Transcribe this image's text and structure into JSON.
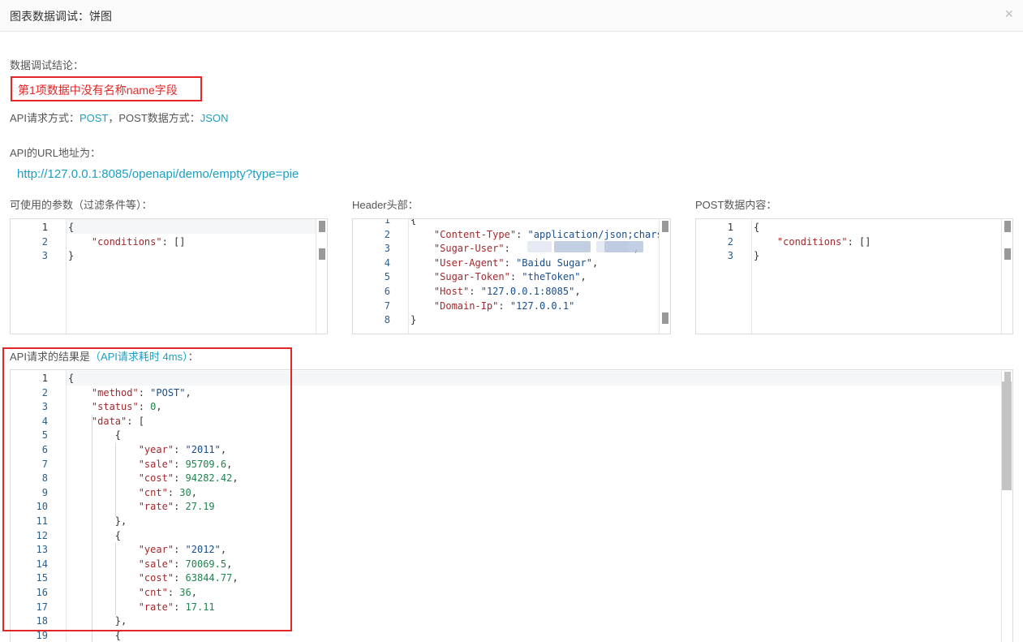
{
  "modal": {
    "title": "图表数据调试：饼图",
    "close_glyph": "×"
  },
  "conclusion": {
    "label": "数据调试结论：",
    "message": "第1项数据中没有名称name字段"
  },
  "request_method": {
    "prefix": "API请求方式：",
    "method": "POST",
    "sep": "，POST数据方式：",
    "post_type": "JSON"
  },
  "url": {
    "label": "API的URL地址为：",
    "value": "http://127.0.0.1:8085/openapi/demo/empty?type=pie"
  },
  "params_panel": {
    "label": "可使用的参数（过滤条件等）：",
    "lines": [
      {
        "num": "1",
        "parts": [
          {
            "t": "{",
            "c": "p"
          }
        ]
      },
      {
        "num": "2",
        "parts": [
          {
            "t": "    ",
            "c": "p"
          },
          {
            "t": "\"conditions\"",
            "c": "k"
          },
          {
            "t": ": []",
            "c": "p"
          }
        ]
      },
      {
        "num": "3",
        "parts": [
          {
            "t": "}",
            "c": "p"
          }
        ]
      }
    ]
  },
  "header_panel": {
    "label": "Header头部：",
    "lines": [
      {
        "num": "1",
        "parts": [
          {
            "t": "{",
            "c": "p"
          }
        ]
      },
      {
        "num": "2",
        "parts": [
          {
            "t": "    ",
            "c": "p"
          },
          {
            "t": "\"Content-Type\"",
            "c": "k"
          },
          {
            "t": ": ",
            "c": "p"
          },
          {
            "t": "\"application/json;charset=",
            "c": "s"
          }
        ]
      },
      {
        "num": "3",
        "parts": [
          {
            "t": "    ",
            "c": "p"
          },
          {
            "t": "\"Sugar-User\"",
            "c": "k"
          },
          {
            "t": ":                     ,",
            "c": "p"
          }
        ]
      },
      {
        "num": "4",
        "parts": [
          {
            "t": "    ",
            "c": "p"
          },
          {
            "t": "\"User-Agent\"",
            "c": "k"
          },
          {
            "t": ": ",
            "c": "p"
          },
          {
            "t": "\"Baidu Sugar\"",
            "c": "s"
          },
          {
            "t": ",",
            "c": "p"
          }
        ]
      },
      {
        "num": "5",
        "parts": [
          {
            "t": "    ",
            "c": "p"
          },
          {
            "t": "\"Sugar-Token\"",
            "c": "k"
          },
          {
            "t": ": ",
            "c": "p"
          },
          {
            "t": "\"theToken\"",
            "c": "s"
          },
          {
            "t": ",",
            "c": "p"
          }
        ]
      },
      {
        "num": "6",
        "parts": [
          {
            "t": "    ",
            "c": "p"
          },
          {
            "t": "\"Host\"",
            "c": "k"
          },
          {
            "t": ": ",
            "c": "p"
          },
          {
            "t": "\"127.0.0.1:8085\"",
            "c": "s"
          },
          {
            "t": ",",
            "c": "p"
          }
        ]
      },
      {
        "num": "7",
        "parts": [
          {
            "t": "    ",
            "c": "p"
          },
          {
            "t": "\"Domain-Ip\"",
            "c": "k"
          },
          {
            "t": ": ",
            "c": "p"
          },
          {
            "t": "\"127.0.0.1\"",
            "c": "s"
          }
        ]
      },
      {
        "num": "8",
        "parts": [
          {
            "t": "}",
            "c": "p"
          }
        ]
      }
    ]
  },
  "post_panel": {
    "label": "POST数据内容：",
    "lines": [
      {
        "num": "1",
        "parts": [
          {
            "t": "{",
            "c": "p"
          }
        ]
      },
      {
        "num": "2",
        "parts": [
          {
            "t": "    ",
            "c": "p"
          },
          {
            "t": "\"conditions\"",
            "c": "k"
          },
          {
            "t": ": []",
            "c": "p"
          }
        ]
      },
      {
        "num": "3",
        "parts": [
          {
            "t": "}",
            "c": "p"
          }
        ]
      }
    ]
  },
  "result": {
    "label_prefix": "API请求的结果是",
    "label_timing": "（API请求耗时 4ms）",
    "label_suffix": "：",
    "lines": [
      {
        "num": "1",
        "parts": [
          {
            "t": "{",
            "c": "p"
          }
        ]
      },
      {
        "num": "2",
        "parts": [
          {
            "t": "    ",
            "c": "p"
          },
          {
            "t": "\"method\"",
            "c": "k"
          },
          {
            "t": ": ",
            "c": "p"
          },
          {
            "t": "\"POST\"",
            "c": "s"
          },
          {
            "t": ",",
            "c": "p"
          }
        ]
      },
      {
        "num": "3",
        "parts": [
          {
            "t": "    ",
            "c": "p"
          },
          {
            "t": "\"status\"",
            "c": "k"
          },
          {
            "t": ": ",
            "c": "p"
          },
          {
            "t": "0",
            "c": "n"
          },
          {
            "t": ",",
            "c": "p"
          }
        ]
      },
      {
        "num": "4",
        "parts": [
          {
            "t": "    ",
            "c": "p"
          },
          {
            "t": "\"data\"",
            "c": "k"
          },
          {
            "t": ": [",
            "c": "p"
          }
        ]
      },
      {
        "num": "5",
        "parts": [
          {
            "t": "        {",
            "c": "p"
          }
        ]
      },
      {
        "num": "6",
        "parts": [
          {
            "t": "            ",
            "c": "p"
          },
          {
            "t": "\"year\"",
            "c": "k"
          },
          {
            "t": ": ",
            "c": "p"
          },
          {
            "t": "\"2011\"",
            "c": "s"
          },
          {
            "t": ",",
            "c": "p"
          }
        ]
      },
      {
        "num": "7",
        "parts": [
          {
            "t": "            ",
            "c": "p"
          },
          {
            "t": "\"sale\"",
            "c": "k"
          },
          {
            "t": ": ",
            "c": "p"
          },
          {
            "t": "95709.6",
            "c": "n"
          },
          {
            "t": ",",
            "c": "p"
          }
        ]
      },
      {
        "num": "8",
        "parts": [
          {
            "t": "            ",
            "c": "p"
          },
          {
            "t": "\"cost\"",
            "c": "k"
          },
          {
            "t": ": ",
            "c": "p"
          },
          {
            "t": "94282.42",
            "c": "n"
          },
          {
            "t": ",",
            "c": "p"
          }
        ]
      },
      {
        "num": "9",
        "parts": [
          {
            "t": "            ",
            "c": "p"
          },
          {
            "t": "\"cnt\"",
            "c": "k"
          },
          {
            "t": ": ",
            "c": "p"
          },
          {
            "t": "30",
            "c": "n"
          },
          {
            "t": ",",
            "c": "p"
          }
        ]
      },
      {
        "num": "10",
        "parts": [
          {
            "t": "            ",
            "c": "p"
          },
          {
            "t": "\"rate\"",
            "c": "k"
          },
          {
            "t": ": ",
            "c": "p"
          },
          {
            "t": "27.19",
            "c": "n"
          }
        ]
      },
      {
        "num": "11",
        "parts": [
          {
            "t": "        },",
            "c": "p"
          }
        ]
      },
      {
        "num": "12",
        "parts": [
          {
            "t": "        {",
            "c": "p"
          }
        ]
      },
      {
        "num": "13",
        "parts": [
          {
            "t": "            ",
            "c": "p"
          },
          {
            "t": "\"year\"",
            "c": "k"
          },
          {
            "t": ": ",
            "c": "p"
          },
          {
            "t": "\"2012\"",
            "c": "s"
          },
          {
            "t": ",",
            "c": "p"
          }
        ]
      },
      {
        "num": "14",
        "parts": [
          {
            "t": "            ",
            "c": "p"
          },
          {
            "t": "\"sale\"",
            "c": "k"
          },
          {
            "t": ": ",
            "c": "p"
          },
          {
            "t": "70069.5",
            "c": "n"
          },
          {
            "t": ",",
            "c": "p"
          }
        ]
      },
      {
        "num": "15",
        "parts": [
          {
            "t": "            ",
            "c": "p"
          },
          {
            "t": "\"cost\"",
            "c": "k"
          },
          {
            "t": ": ",
            "c": "p"
          },
          {
            "t": "63844.77",
            "c": "n"
          },
          {
            "t": ",",
            "c": "p"
          }
        ]
      },
      {
        "num": "16",
        "parts": [
          {
            "t": "            ",
            "c": "p"
          },
          {
            "t": "\"cnt\"",
            "c": "k"
          },
          {
            "t": ": ",
            "c": "p"
          },
          {
            "t": "36",
            "c": "n"
          },
          {
            "t": ",",
            "c": "p"
          }
        ]
      },
      {
        "num": "17",
        "parts": [
          {
            "t": "            ",
            "c": "p"
          },
          {
            "t": "\"rate\"",
            "c": "k"
          },
          {
            "t": ": ",
            "c": "p"
          },
          {
            "t": "17.11",
            "c": "n"
          }
        ]
      },
      {
        "num": "18",
        "parts": [
          {
            "t": "        },",
            "c": "p"
          }
        ]
      },
      {
        "num": "19",
        "parts": [
          {
            "t": "        {",
            "c": "p"
          }
        ]
      }
    ]
  },
  "colors": {
    "accent": "#1a9fc4",
    "error": "#e32626",
    "key": "#a3282d",
    "string": "#1a4e8a",
    "number": "#21834f"
  }
}
